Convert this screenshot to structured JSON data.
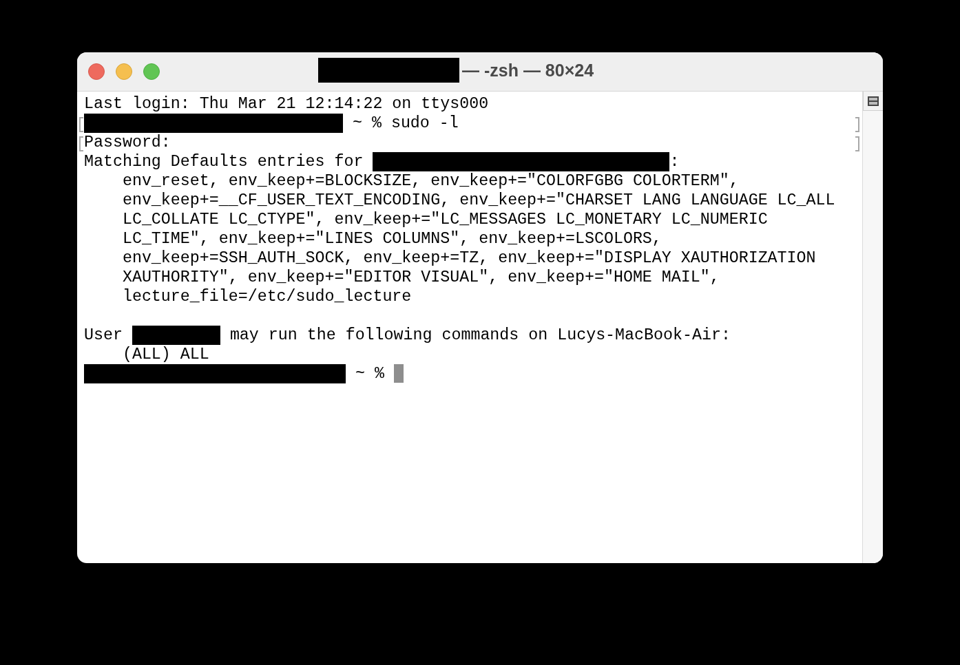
{
  "window": {
    "title": "— -zsh — 80×24",
    "title_redacted": true
  },
  "terminal": {
    "lines": [
      {
        "marked": false,
        "segments": [
          {
            "kind": "text",
            "text": "Last login: Thu Mar 21 12:14:22 on ttys000"
          }
        ]
      },
      {
        "marked": true,
        "segments": [
          {
            "kind": "redaction"
          },
          {
            "kind": "text",
            "text": " ~ % sudo -l"
          }
        ]
      },
      {
        "marked": true,
        "segments": [
          {
            "kind": "text",
            "text": "Password:"
          }
        ]
      },
      {
        "marked": false,
        "segments": [
          {
            "kind": "text",
            "text": "Matching Defaults entries for "
          },
          {
            "kind": "redaction"
          },
          {
            "kind": "text",
            "text": ":"
          }
        ]
      },
      {
        "marked": false,
        "segments": [
          {
            "kind": "text",
            "text": "    env_reset, env_keep+=BLOCKSIZE, env_keep+=\"COLORFGBG COLORTERM\","
          }
        ]
      },
      {
        "marked": false,
        "segments": [
          {
            "kind": "text",
            "text": "    env_keep+=__CF_USER_TEXT_ENCODING, env_keep+=\"CHARSET LANG LANGUAGE LC_ALL"
          }
        ]
      },
      {
        "marked": false,
        "segments": [
          {
            "kind": "text",
            "text": "    LC_COLLATE LC_CTYPE\", env_keep+=\"LC_MESSAGES LC_MONETARY LC_NUMERIC"
          }
        ]
      },
      {
        "marked": false,
        "segments": [
          {
            "kind": "text",
            "text": "    LC_TIME\", env_keep+=\"LINES COLUMNS\", env_keep+=LSCOLORS,"
          }
        ]
      },
      {
        "marked": false,
        "segments": [
          {
            "kind": "text",
            "text": "    env_keep+=SSH_AUTH_SOCK, env_keep+=TZ, env_keep+=\"DISPLAY XAUTHORIZATION"
          }
        ]
      },
      {
        "marked": false,
        "segments": [
          {
            "kind": "text",
            "text": "    XAUTHORITY\", env_keep+=\"EDITOR VISUAL\", env_keep+=\"HOME MAIL\","
          }
        ]
      },
      {
        "marked": false,
        "segments": [
          {
            "kind": "text",
            "text": "    lecture_file=/etc/sudo_lecture"
          }
        ]
      },
      {
        "marked": false
      },
      {
        "marked": false,
        "segments": [
          {
            "kind": "text",
            "text": "User "
          },
          {
            "kind": "redaction"
          },
          {
            "kind": "text",
            "text": " may run the following commands on Lucys-MacBook-Air:"
          }
        ]
      },
      {
        "marked": false,
        "segments": [
          {
            "kind": "text",
            "text": "    (ALL) ALL"
          }
        ]
      },
      {
        "marked": false,
        "cursor": true,
        "segments": [
          {
            "kind": "redaction"
          },
          {
            "kind": "text",
            "text": " ~ % "
          }
        ]
      }
    ]
  }
}
